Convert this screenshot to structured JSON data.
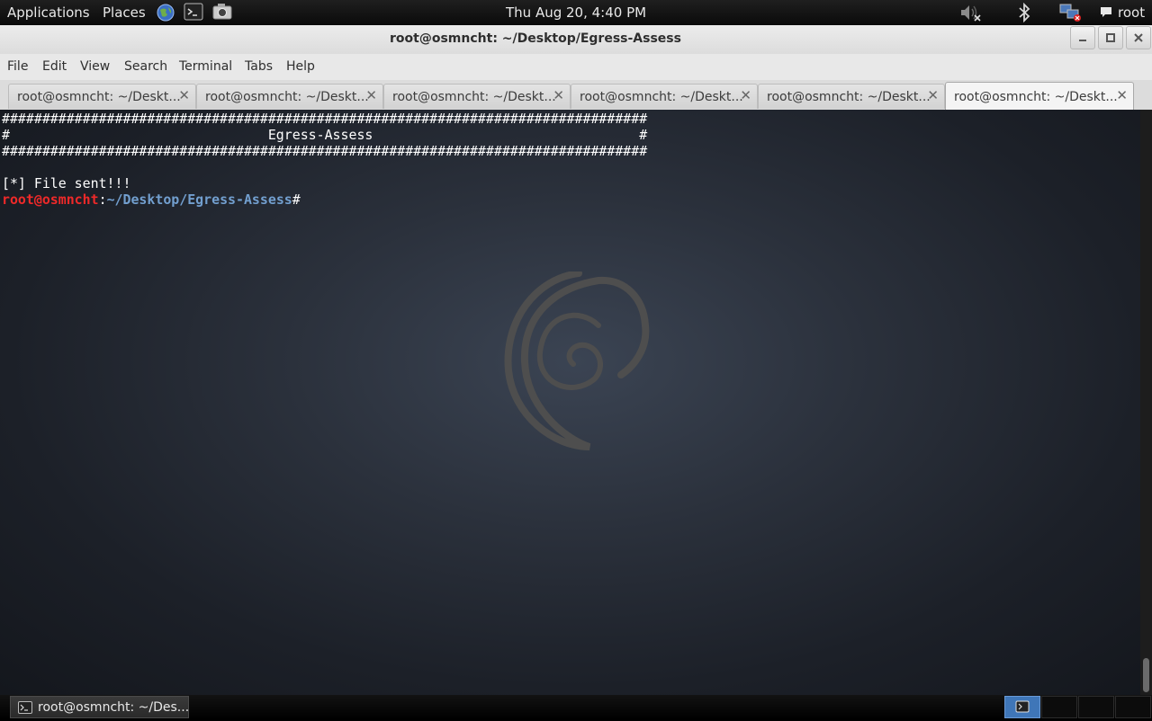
{
  "top_panel": {
    "applications": "Applications",
    "places": "Places",
    "clock": "Thu Aug 20,  4:40 PM",
    "user": "root"
  },
  "window": {
    "title": "root@osmncht: ~/Desktop/Egress-Assess",
    "minimize_icon": "minimize-icon",
    "maximize_icon": "maximize-icon",
    "close_icon": "close-icon"
  },
  "menubar": {
    "items": [
      "File",
      "Edit",
      "View",
      "Search",
      "Terminal",
      "Tabs",
      "Help"
    ]
  },
  "tabs": [
    {
      "label": "root@osmncht: ~/Deskt...",
      "active": false
    },
    {
      "label": "root@osmncht: ~/Deskt...",
      "active": false
    },
    {
      "label": "root@osmncht: ~/Deskt...",
      "active": false
    },
    {
      "label": "root@osmncht: ~/Deskt...",
      "active": false
    },
    {
      "label": "root@osmncht: ~/Deskt...",
      "active": false
    },
    {
      "label": "root@osmncht: ~/Deskt...",
      "active": true
    }
  ],
  "tab_close_glyph": "✕",
  "terminal": {
    "lines": [
      "################################################################################",
      "#                                Egress-Assess                                 #",
      "################################################################################",
      "",
      "[*] File sent!!!"
    ],
    "prompt_user": "root@osmncht",
    "prompt_sep": ":",
    "prompt_path": "~/Desktop/Egress-Assess",
    "prompt_end": "#"
  },
  "taskbar": {
    "task_label": "root@osmncht: ~/Des..."
  },
  "colors": {
    "prompt_user": "#ef2929",
    "prompt_path": "#729fcf",
    "workspace_active": "#3f76b8"
  }
}
